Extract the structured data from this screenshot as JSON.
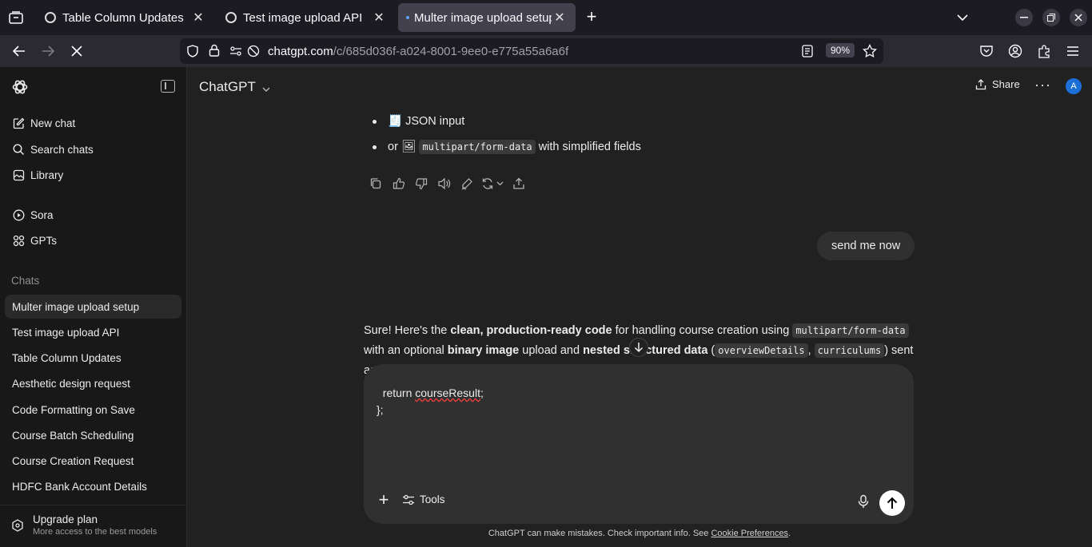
{
  "browser": {
    "tabs": [
      {
        "label": "Table Column Updates",
        "close": "✕"
      },
      {
        "label": "Test image upload API",
        "close": "✕"
      },
      {
        "label": "Multer image upload setup",
        "close": "✕"
      }
    ],
    "new_tab": "+",
    "url_domain": "chatgpt.com",
    "url_path": "/c/685d036f-a024-8001-9ee0-e775a55a6a6f",
    "zoom": "90%"
  },
  "sidebar": {
    "top_items": [
      {
        "label": "New chat",
        "icon": "new-chat-icon"
      },
      {
        "label": "Search chats",
        "icon": "search-icon"
      },
      {
        "label": "Library",
        "icon": "library-icon"
      }
    ],
    "mid_items": [
      {
        "label": "Sora",
        "icon": "play-icon"
      },
      {
        "label": "GPTs",
        "icon": "grid-icon"
      }
    ],
    "section_title": "Chats",
    "chats": [
      "Multer image upload setup",
      "Test image upload API",
      "Table Column Updates",
      "Aesthetic design request",
      "Code Formatting on Save",
      "Course Batch Scheduling",
      "Course Creation Request",
      "HDFC Bank Account Details"
    ],
    "upgrade_title": "Upgrade plan",
    "upgrade_subtitle": "More access to the best models"
  },
  "header": {
    "model": "ChatGPT",
    "share": "Share",
    "more": "···",
    "avatar_initial": "A"
  },
  "conversation": {
    "bullets": {
      "b1_emoji": "🧾",
      "b1_text": "JSON input",
      "b2_prefix": "or",
      "b2_emoji": "🖼",
      "b2_code": "multipart/form-data",
      "b2_text": "with simplified fields"
    },
    "user_message": "send me now",
    "answer": {
      "p1": "Sure! Here's the ",
      "b1": "clean, production-ready code",
      "p2": " for handling course creation using ",
      "c1": "multipart/form-data",
      "p3": "with an optional ",
      "b2": "binary image",
      "p4": " upload and ",
      "b3": "nested structured data",
      "p5": " (",
      "c2": "overviewDetails",
      "p6": ", ",
      "c3": "curriculums",
      "p7": ") sent",
      "p8": "as"
    }
  },
  "composer": {
    "line1_prefix": "  return ",
    "line1_word": "courseResult",
    "line1_suffix": ";",
    "line2": "};",
    "plus": "+",
    "tools": "Tools"
  },
  "footer": {
    "text": "ChatGPT can make mistakes. Check important info. See ",
    "link": "Cookie Preferences",
    "end": "."
  }
}
